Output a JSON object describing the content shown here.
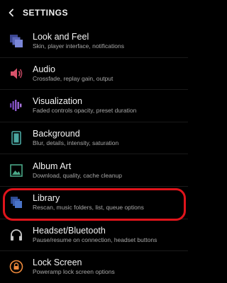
{
  "header": {
    "title": "SETTINGS"
  },
  "items": [
    {
      "title": "Look and Feel",
      "subtitle": "Skin, player interface, notifications"
    },
    {
      "title": "Audio",
      "subtitle": "Crossfade, replay gain, output"
    },
    {
      "title": "Visualization",
      "subtitle": "Faded controls opacity, preset duration"
    },
    {
      "title": "Background",
      "subtitle": "Blur, details, intensity, saturation"
    },
    {
      "title": "Album Art",
      "subtitle": "Download, quality, cache cleanup"
    },
    {
      "title": "Library",
      "subtitle": "Rescan, music folders, list, queue options"
    },
    {
      "title": "Headset/Bluetooth",
      "subtitle": "Pause/resume on connection, headset buttons"
    },
    {
      "title": "Lock Screen",
      "subtitle": "Poweramp lock screen options"
    }
  ],
  "icons": [
    "chevron-left-icon",
    "layers-icon",
    "speaker-icon",
    "equalizer-bars-icon",
    "phone-frame-icon",
    "image-icon",
    "library-stack-icon",
    "headset-icon",
    "lock-icon"
  ],
  "colors": {
    "background": "#000000",
    "highlight": "#e0141b",
    "look_and_feel_icon": "#5a66b8",
    "audio_icon": "#d8526a",
    "visualization_icon": "#8a56c8",
    "background_icon": "#4aa6a0",
    "album_art_icon": "#4aa888",
    "library_icon": "#4a73c8",
    "headset_icon": "#c8c8c8",
    "lock_icon": "#f08a3c"
  }
}
